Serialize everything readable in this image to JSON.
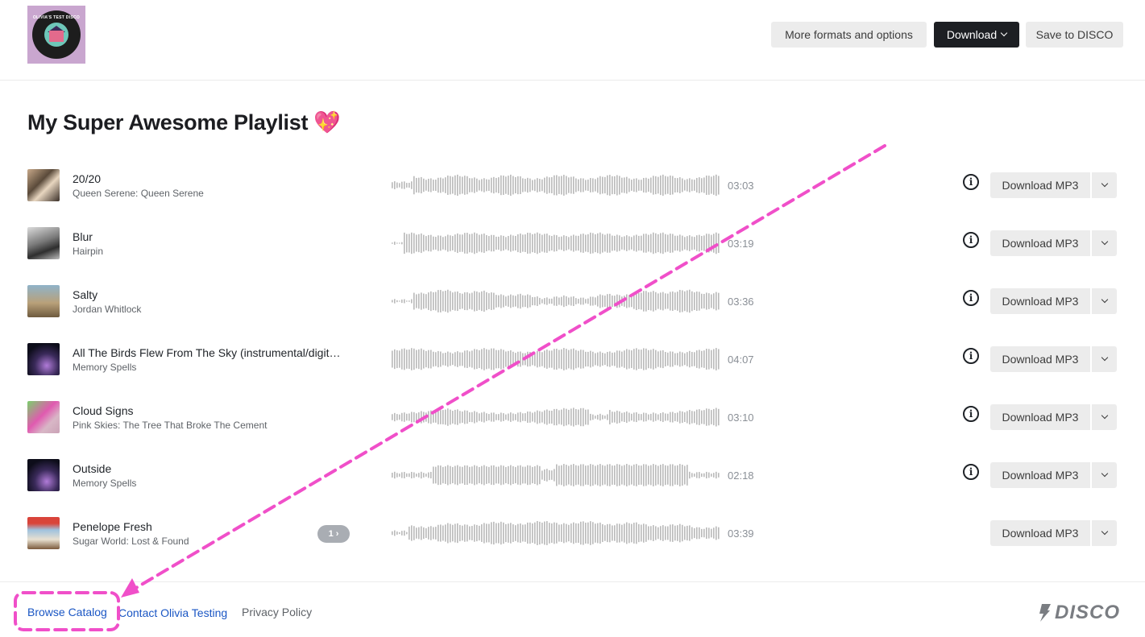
{
  "header": {
    "logo_text": "OLIVIA'S TEST DISCO",
    "more_label": "More formats and options",
    "download_label": "Download",
    "save_label": "Save to DISCO"
  },
  "playlist": {
    "title": "My Super Awesome Playlist 💖"
  },
  "tracks": [
    {
      "name": "20/20",
      "artist": "Queen Serene: Queen Serene",
      "duration": "03:03",
      "download_label": "Download MP3",
      "has_info": true
    },
    {
      "name": "Blur",
      "artist": "Hairpin",
      "duration": "03:19",
      "download_label": "Download MP3",
      "has_info": true
    },
    {
      "name": "Salty",
      "artist": "Jordan Whitlock",
      "duration": "03:36",
      "download_label": "Download MP3",
      "has_info": true
    },
    {
      "name": "All The Birds Flew From The Sky (instrumental/digit…",
      "artist": "Memory Spells",
      "duration": "04:07",
      "download_label": "Download MP3",
      "has_info": true
    },
    {
      "name": "Cloud Signs",
      "artist": "Pink Skies: The Tree That Broke The Cement",
      "duration": "03:10",
      "download_label": "Download MP3",
      "has_info": true
    },
    {
      "name": "Outside",
      "artist": "Memory Spells",
      "duration": "02:18",
      "download_label": "Download MP3",
      "has_info": true
    },
    {
      "name": "Penelope Fresh",
      "artist": "Sugar World: Lost & Found",
      "duration": "03:39",
      "download_label": "Download MP3",
      "has_info": false,
      "version_badge": "1"
    }
  ],
  "footer": {
    "browse": "Browse Catalog",
    "contact": "Contact Olivia Testing",
    "privacy": "Privacy Policy",
    "brand": "DISCO"
  },
  "colors": {
    "accent_dark": "#1d1f23",
    "link": "#1a56c4",
    "annotation": "#f04fc9"
  }
}
